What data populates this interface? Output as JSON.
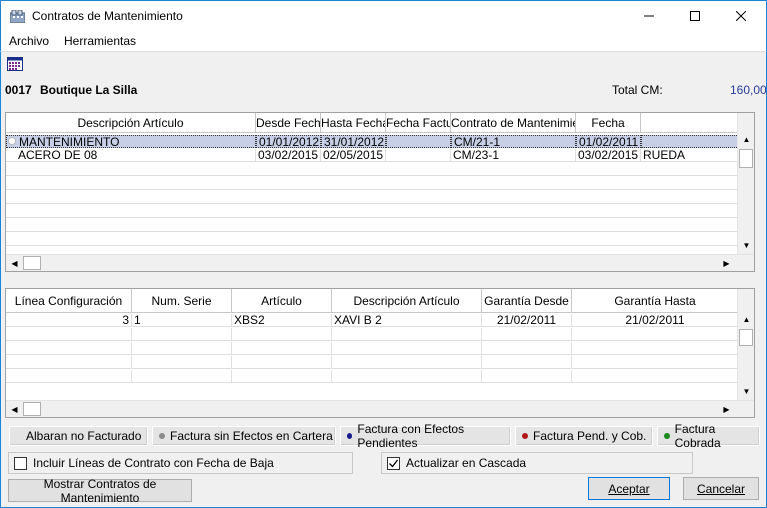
{
  "window": {
    "title": "Contratos de Mantenimiento",
    "minimize": "—",
    "maximize": "☐",
    "close": "✕"
  },
  "menu": [
    "Archivo",
    "Herramientas"
  ],
  "header": {
    "customer_code": "0017",
    "customer_name": "Boutique La Silla",
    "total_label": "Total CM:",
    "total_value": "160,00"
  },
  "contracts_grid": {
    "columns": [
      "Descripción Artículo",
      "Desde Fecha",
      "Hasta Fecha",
      "Fecha Factura",
      "Contrato de Mantenimiento",
      "Fecha",
      ""
    ],
    "rows": [
      [
        "MANTENIMIENTO",
        "01/01/2012",
        "31/01/2012",
        "",
        "CM/21-1",
        "01/02/2011",
        ""
      ],
      [
        "ACERO DE 08",
        "03/02/2015",
        "02/05/2015",
        "",
        "CM/23-1",
        "03/02/2015",
        "RUEDA"
      ]
    ]
  },
  "lines_grid": {
    "columns": [
      "Línea Configuración",
      "Num. Serie",
      "Artículo",
      "Descripción Artículo",
      "Garantía Desde",
      "Garantía Hasta"
    ],
    "rows": [
      [
        "3",
        "1",
        "XBS2",
        "XAVI B 2",
        "21/02/2011",
        "21/02/2011"
      ]
    ]
  },
  "legend": [
    {
      "label": "Albaran no Facturado",
      "color": ""
    },
    {
      "label": "Factura sin Efectos en Cartera",
      "color": "#8a8a8a"
    },
    {
      "label": "Factura con Efectos Pendientes",
      "color": "#1a1a8c"
    },
    {
      "label": "Factura Pend. y Cob.",
      "color": "#b01818"
    },
    {
      "label": "Factura Cobrada",
      "color": "#1a8c1a"
    }
  ],
  "options": {
    "include_baja": {
      "label": "Incluir Líneas de Contrato con Fecha de Baja",
      "checked": false
    },
    "cascade": {
      "label": "Actualizar en Cascada",
      "checked": true
    }
  },
  "buttons": {
    "show_contracts": "Mostrar Contratos de Mantenimiento",
    "accept": "Aceptar",
    "cancel": "Cancelar"
  }
}
